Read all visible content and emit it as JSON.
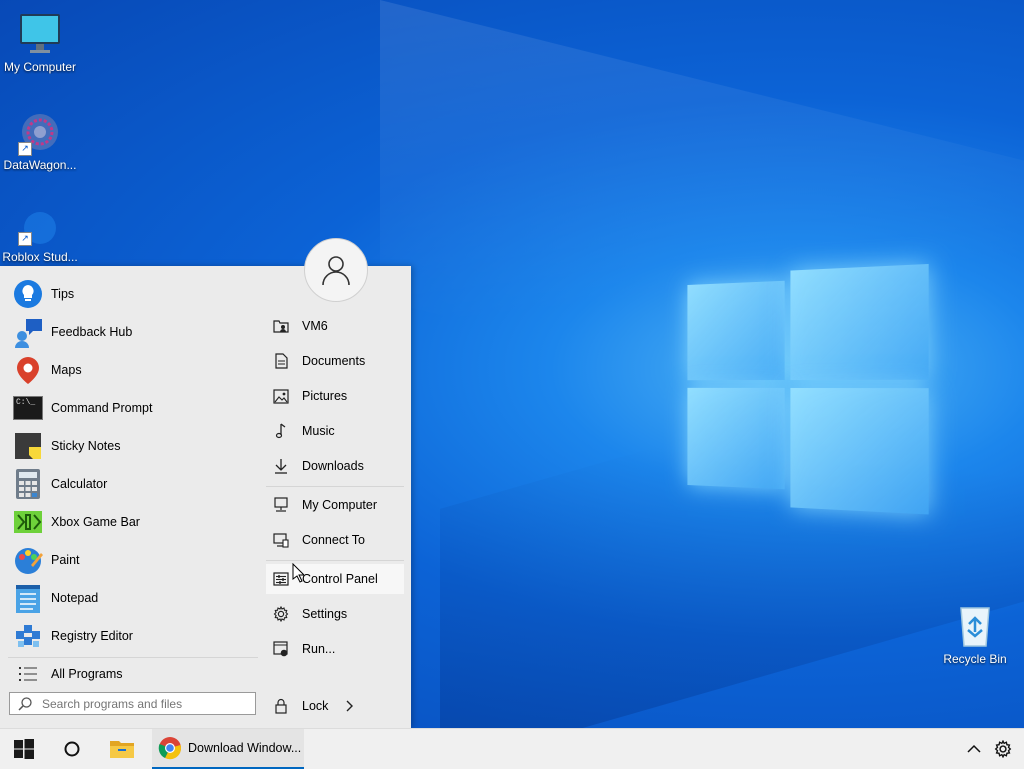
{
  "desktop": {
    "icons": [
      {
        "label": "My Computer",
        "icon": "monitor-icon"
      },
      {
        "label": "DataWagon...",
        "icon": "app-icon"
      },
      {
        "label": "Roblox Stud...",
        "icon": "roblox-icon"
      },
      {
        "label": "Recycle Bin",
        "icon": "recycle-bin-icon"
      }
    ]
  },
  "start_menu": {
    "apps": [
      {
        "label": "Tips",
        "icon": "lightbulb-icon"
      },
      {
        "label": "Feedback Hub",
        "icon": "feedback-icon"
      },
      {
        "label": "Maps",
        "icon": "map-pin-icon"
      },
      {
        "label": "Command Prompt",
        "icon": "terminal-icon"
      },
      {
        "label": "Sticky Notes",
        "icon": "sticky-note-icon"
      },
      {
        "label": "Calculator",
        "icon": "calculator-icon"
      },
      {
        "label": "Xbox Game Bar",
        "icon": "xbox-icon"
      },
      {
        "label": "Paint",
        "icon": "paint-icon"
      },
      {
        "label": "Notepad",
        "icon": "notepad-icon"
      },
      {
        "label": "Registry Editor",
        "icon": "registry-icon"
      }
    ],
    "all_programs": "All Programs",
    "search_placeholder": "Search programs and files",
    "right": [
      {
        "label": "VM6",
        "icon": "user-folder-icon"
      },
      {
        "label": "Documents",
        "icon": "document-icon"
      },
      {
        "label": "Pictures",
        "icon": "picture-icon"
      },
      {
        "label": "Music",
        "icon": "music-note-icon"
      },
      {
        "label": "Downloads",
        "icon": "download-icon"
      },
      {
        "label": "My Computer",
        "icon": "computer-icon"
      },
      {
        "label": "Connect To",
        "icon": "connect-icon"
      },
      {
        "label": "Control Panel",
        "icon": "control-panel-icon"
      },
      {
        "label": "Settings",
        "icon": "gear-icon"
      },
      {
        "label": "Run...",
        "icon": "run-icon"
      }
    ],
    "lock_label": "Lock",
    "c_prompt_text": "C:\\_"
  },
  "taskbar": {
    "chrome_title": "Download Window..."
  },
  "colors": {
    "accent": "#0067c0",
    "desktop_blue": "#0c63d6"
  }
}
